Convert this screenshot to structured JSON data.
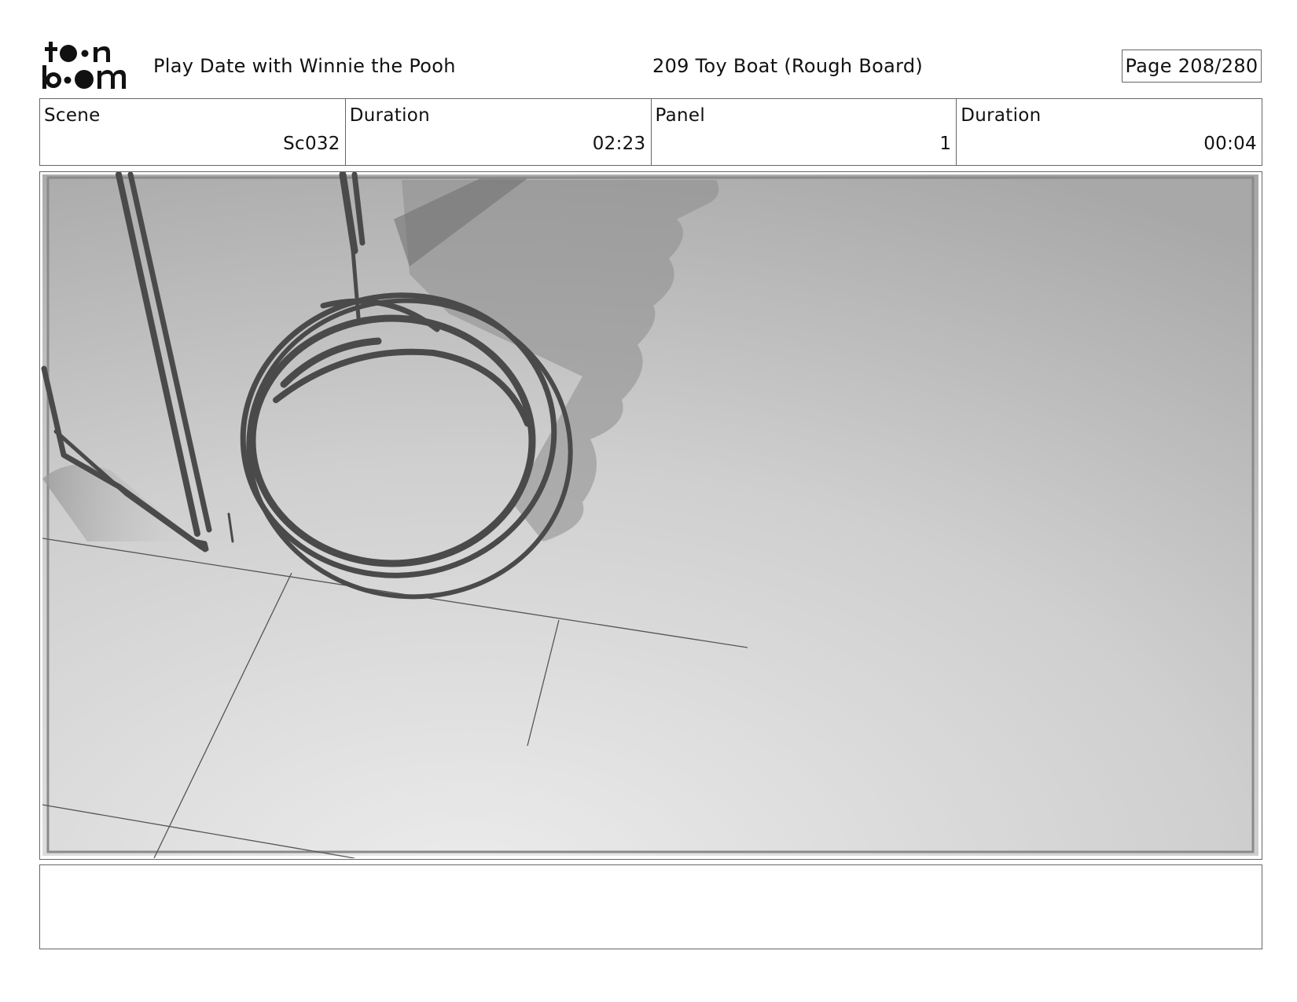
{
  "header": {
    "logo_icon": "toonboom-logo-icon",
    "project_title": "Play Date with Winnie the Pooh",
    "board_title": "209 Toy Boat (Rough Board)",
    "page_label": "Page 208/280"
  },
  "info": {
    "scene_label": "Scene",
    "scene_value": "Sc032",
    "scene_duration_label": "Duration",
    "scene_duration_value": "02:23",
    "panel_label": "Panel",
    "panel_value": "1",
    "panel_duration_label": "Duration",
    "panel_duration_value": "00:04"
  },
  "panel": {
    "image_icon": "rough-sketch-toy-boat-ring",
    "colors": {
      "sketch_stroke": "#4a4a4a",
      "bg_light": "#e8e8e8",
      "bg_dark": "#a9a9a9",
      "shadow": "#8a8a8a"
    }
  },
  "notes": {
    "text": ""
  }
}
